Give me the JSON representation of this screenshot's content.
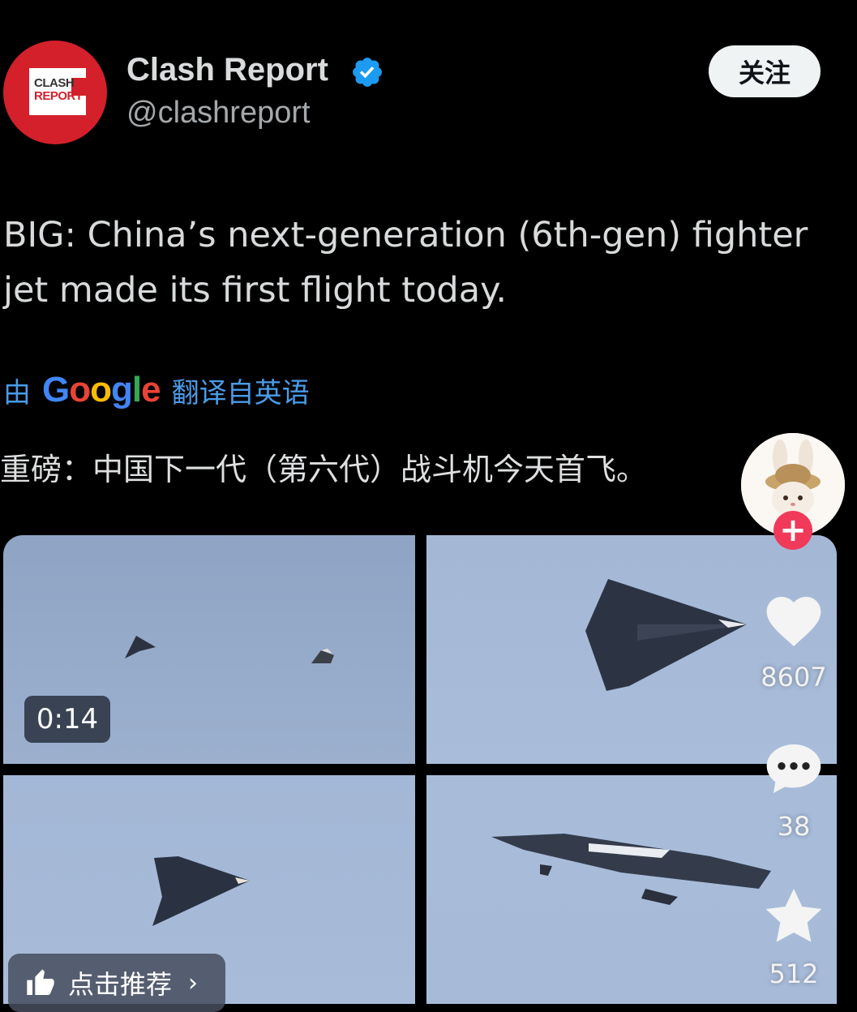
{
  "account": {
    "avatar_text_1": "CLASH",
    "avatar_text_2": "REPORT",
    "name": "Clash Report",
    "handle": "@clashreport",
    "follow_label": "关注"
  },
  "tweet": {
    "text": "BIG: China’s next-generation (6th-gen) fighter jet made its first flight today.",
    "translate_by": "由",
    "translate_brand": "Google",
    "translate_from": "翻译自英语",
    "translation": "重磅：中国下一代（第六代）战斗机今天首飞。"
  },
  "media": {
    "duration": "0:14",
    "recommend_label": "点击推荐",
    "recommend_chevron": "›"
  },
  "sidebar": {
    "follow_plus": "+",
    "likes": "8607",
    "comments": "38",
    "stars": "512"
  },
  "colors": {
    "avatar_red": "#d3202b",
    "verified_blue": "#1d9bf0",
    "translate_blue": "#4a9be8",
    "plus_pink": "#f1395a"
  }
}
